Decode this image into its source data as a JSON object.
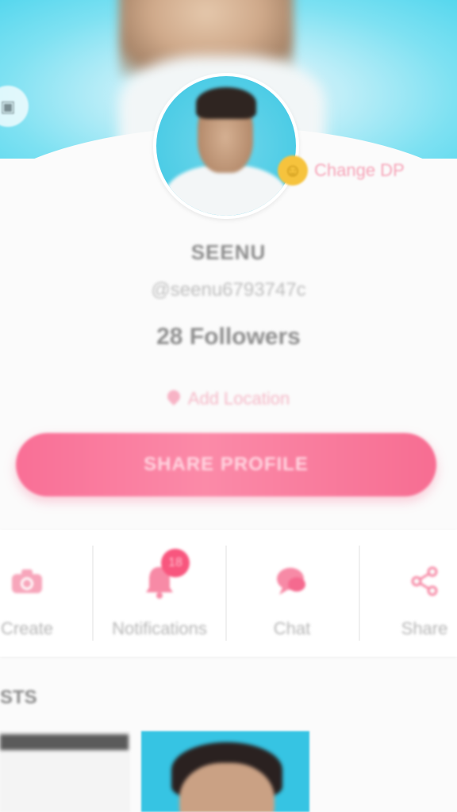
{
  "profile": {
    "change_dp_label": "Change DP",
    "username": "SEENU",
    "handle": "@seenu6793747c",
    "followers": "28 Followers",
    "location_label": "Add Location",
    "share_profile_label": "SHARE PROFILE"
  },
  "actions": [
    {
      "label": "Create",
      "icon": "camera-icon"
    },
    {
      "label": "Notifications",
      "icon": "bell-icon",
      "badge": "18"
    },
    {
      "label": "Chat",
      "icon": "chat-icon"
    },
    {
      "label": "Share",
      "icon": "share-icon"
    }
  ],
  "posts": {
    "title": "STS"
  },
  "colors": {
    "accent": "#f96f96",
    "cover": "#56d7ee",
    "muted_text": "#b5b5b5"
  }
}
